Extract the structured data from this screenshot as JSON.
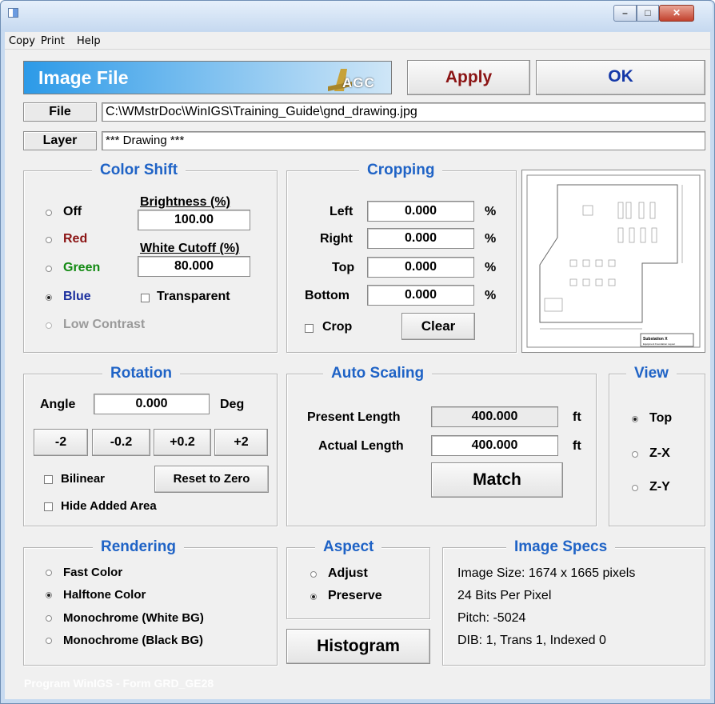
{
  "menu": [
    "Copy",
    "Print",
    "Help"
  ],
  "window_controls": {
    "minimize": "–",
    "maximize": "□",
    "close": "✕"
  },
  "header": {
    "title": "Image File",
    "logo_text": "AGC"
  },
  "actions": {
    "apply": "Apply",
    "ok": "OK"
  },
  "file": {
    "label": "File",
    "value": "C:\\WMstrDoc\\WinIGS\\Training_Guide\\gnd_drawing.jpg"
  },
  "layer": {
    "label": "Layer",
    "value": "*** Drawing ***"
  },
  "color_shift": {
    "title": "Color Shift",
    "options": [
      {
        "label": "Off",
        "color": "#000000",
        "checked": false
      },
      {
        "label": "Red",
        "color": "#8b1414",
        "checked": false
      },
      {
        "label": "Green",
        "color": "#138a13",
        "checked": false
      },
      {
        "label": "Blue",
        "color": "#1b2f9e",
        "checked": true
      },
      {
        "label": "Low Contrast",
        "color": "#9a9a9a",
        "checked": false
      }
    ],
    "brightness_label": "Brightness (%)",
    "brightness": "100.00",
    "white_cutoff_label": "White Cutoff (%)",
    "white_cutoff": "80.000",
    "transparent_label": "Transparent",
    "transparent_checked": false
  },
  "cropping": {
    "title": "Cropping",
    "rows": [
      {
        "label": "Left",
        "value": "0.000",
        "unit": "%"
      },
      {
        "label": "Right",
        "value": "0.000",
        "unit": "%"
      },
      {
        "label": "Top",
        "value": "0.000",
        "unit": "%"
      },
      {
        "label": "Bottom",
        "value": "0.000",
        "unit": "%"
      }
    ],
    "crop_label": "Crop",
    "crop_checked": false,
    "clear_label": "Clear"
  },
  "preview": {
    "caption_line1": "Substation X",
    "caption_line2": "Equipment Foundation Layout"
  },
  "rotation": {
    "title": "Rotation",
    "angle_label": "Angle",
    "angle": "0.000",
    "unit": "Deg",
    "steps": [
      "-2",
      "-0.2",
      "+0.2",
      "+2"
    ],
    "bilinear_label": "Bilinear",
    "reset_label": "Reset to Zero",
    "hide_added_label": "Hide Added Area"
  },
  "auto_scaling": {
    "title": "Auto Scaling",
    "present_label": "Present Length",
    "present_value": "400.000",
    "actual_label": "Actual Length",
    "actual_value": "400.000",
    "unit": "ft",
    "match_label": "Match"
  },
  "view": {
    "title": "View",
    "options": [
      {
        "label": "Top",
        "checked": true
      },
      {
        "label": "Z-X",
        "checked": false
      },
      {
        "label": "Z-Y",
        "checked": false
      }
    ]
  },
  "rendering": {
    "title": "Rendering",
    "options": [
      {
        "label": "Fast Color",
        "checked": false
      },
      {
        "label": "Halftone Color",
        "checked": true
      },
      {
        "label": "Monochrome (White BG)",
        "checked": false
      },
      {
        "label": "Monochrome (Black BG)",
        "checked": false
      }
    ]
  },
  "aspect": {
    "title": "Aspect",
    "options": [
      {
        "label": "Adjust",
        "checked": false
      },
      {
        "label": "Preserve",
        "checked": true
      }
    ]
  },
  "histogram_label": "Histogram",
  "image_specs": {
    "title": "Image Specs",
    "lines": [
      "Image Size: 1674 x 1665 pixels",
      "24 Bits Per Pixel",
      "Pitch: -5024",
      "DIB: 1, Trans 1, Indexed 0"
    ]
  },
  "footer": "Program WinIGS - Form GRD_GE28"
}
